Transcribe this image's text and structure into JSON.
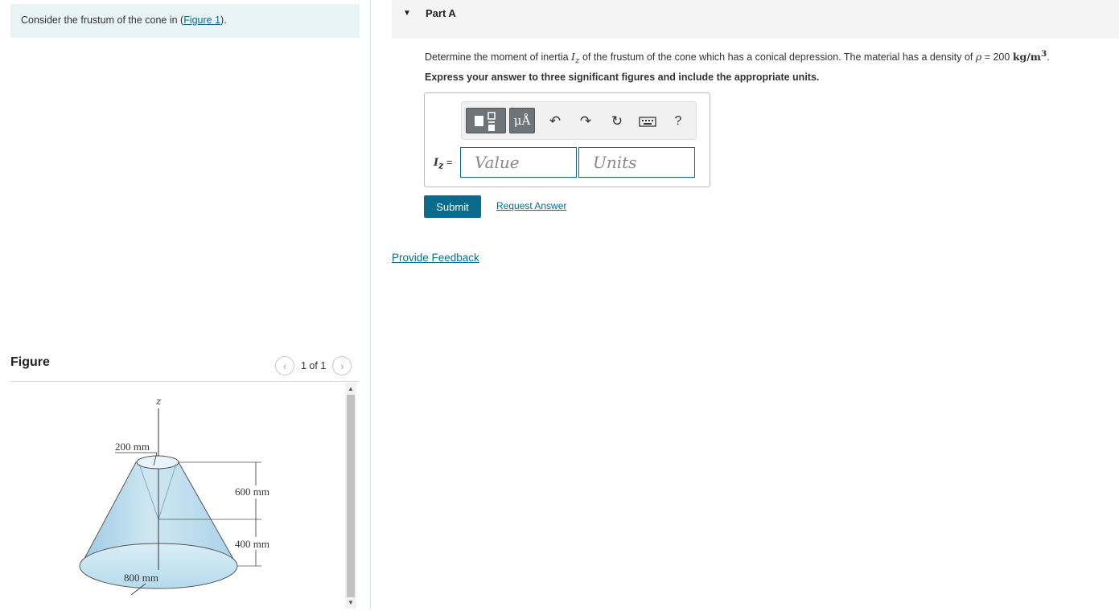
{
  "intro": {
    "text": "Consider the frustum of the cone in (",
    "link": "Figure 1",
    "suffix": ")."
  },
  "figure": {
    "title": "Figure",
    "pager": "1 of 1",
    "axis_label": "z",
    "dim_top": "200 mm",
    "dim_600": "600 mm",
    "dim_400": "400 mm",
    "dim_bottom": "800 mm"
  },
  "part": {
    "label": "Part A",
    "question_prefix": "Determine the moment of inertia ",
    "question_var": "I",
    "question_sub": "z",
    "question_mid": " of the frustum of the cone which has a conical depression. The material has a density of ",
    "rho": "ρ",
    "density_value": " = 200 ",
    "density_unit": "kg/m",
    "density_exp": "3",
    "question_end": ".",
    "instruction": "Express your answer to three significant figures and include the appropriate units."
  },
  "answer": {
    "var": "I",
    "sub": "z",
    "eq": " =",
    "value_placeholder": "Value",
    "units_placeholder": "Units",
    "units_button": "μÅ",
    "help": "?"
  },
  "actions": {
    "submit": "Submit",
    "request_answer": "Request Answer",
    "feedback": "Provide Feedback"
  }
}
